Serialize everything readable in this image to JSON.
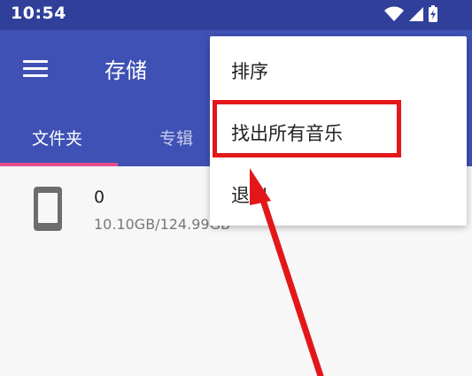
{
  "status_bar": {
    "time": "10:54"
  },
  "app_bar": {
    "title": "存储"
  },
  "tabs": [
    {
      "label": "文件夹",
      "selected": true
    },
    {
      "label": "专辑",
      "selected": false
    }
  ],
  "storage": {
    "name": "0",
    "size": "10.10GB/124.99GB"
  },
  "menu": {
    "items": [
      {
        "label": "排序"
      },
      {
        "label": "找出所有音乐"
      },
      {
        "label": "退出"
      }
    ]
  },
  "colors": {
    "primary": "#3f51b5",
    "status_bar": "#2f3f9a",
    "tab_indicator": "#e84d8a",
    "annotation_red": "#e3171a"
  }
}
